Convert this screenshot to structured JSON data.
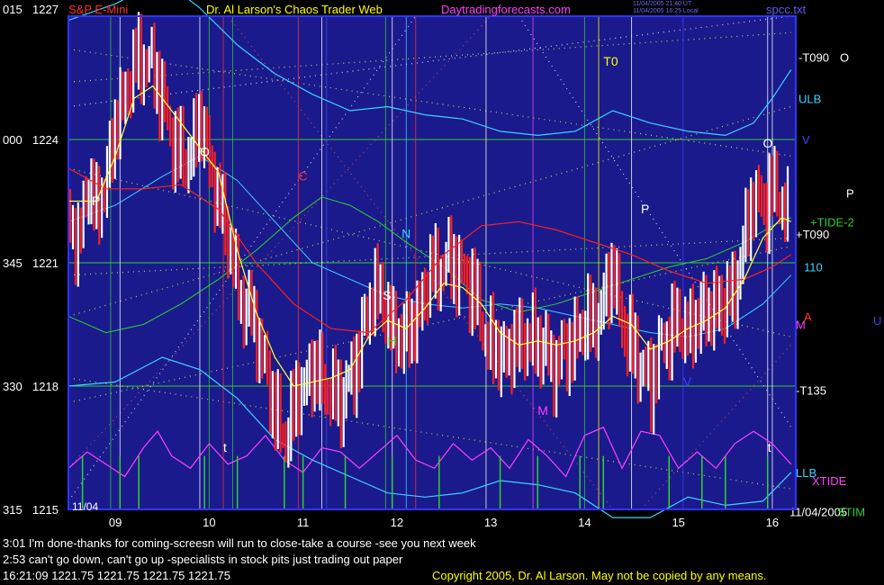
{
  "header": {
    "left_code": "015",
    "left_price": "1227",
    "symbol": "S&P E-Mini",
    "title": "Dr. Al Larson's Chaos Trader Web",
    "site": "Daytradingforecasts.com",
    "date_line1": "11/04/2005 21:40 UT",
    "date_line2": "11/04/2005 16:25 Local",
    "file": "spcc.txt"
  },
  "colors": {
    "background": "#000000",
    "plot_bg": "#1a1a8c",
    "frame": "#3333ff",
    "price_up": "#ffffff",
    "price_down": "#ff2020",
    "ema_fast": "#ffff40",
    "band_outer": "#40d0ff",
    "green": "#30d030",
    "magenta": "#ff40ff",
    "title_red": "#ff3030",
    "title_yellow": "#ffff00",
    "site_magenta": "#ff40ff"
  },
  "left_axis": [
    {
      "code": "000",
      "price": "1224"
    },
    {
      "code": "345",
      "price": "1221"
    },
    {
      "code": "330",
      "price": "1218"
    },
    {
      "code": "315",
      "price": "1215"
    }
  ],
  "right_labels": [
    {
      "text": "-T090",
      "extra": "O",
      "color": "#ffffff"
    },
    {
      "text": "ULB",
      "color": "#40d0ff"
    },
    {
      "text": "V",
      "color": "#4040ff"
    },
    {
      "text": "P",
      "color": "#ffffff"
    },
    {
      "text": "+TIDE-2",
      "color": "#30d030"
    },
    {
      "text": "+T090",
      "color": "#ffffff"
    },
    {
      "text": "110",
      "color": "#40d0ff"
    },
    {
      "text": "A",
      "color": "#ff3030"
    },
    {
      "text": "M",
      "color": "#ff40ff"
    },
    {
      "text": "U",
      "color": "#4040ff"
    },
    {
      "text": "-T135",
      "color": "#ffffff"
    },
    {
      "text": "LLB",
      "color": "#40d0ff"
    },
    {
      "text": "XTIDE",
      "color": "#ff40ff"
    },
    {
      "text": "11/04/2005",
      "color": "#ffffff"
    },
    {
      "text": "STIM",
      "color": "#30d030"
    }
  ],
  "annotations": [
    {
      "text": "O",
      "color": "#ffffff"
    },
    {
      "text": "P",
      "color": "#ffffff"
    },
    {
      "text": "C",
      "color": "#ff3030"
    },
    {
      "text": "N",
      "color": "#40d0ff"
    },
    {
      "text": "S",
      "color": "#ffffff"
    },
    {
      "text": "H",
      "color": "#30d030"
    },
    {
      "text": "T0",
      "color": "#ffff00"
    },
    {
      "text": "P",
      "color": "#ffffff"
    },
    {
      "text": "O",
      "color": "#ffffff"
    },
    {
      "text": "M",
      "color": "#ff40ff"
    },
    {
      "text": "V",
      "color": "#4040ff"
    },
    {
      "text": "t",
      "color": "#ffffff"
    },
    {
      "text": "t",
      "color": "#ffffff"
    }
  ],
  "date_corner": "11/04",
  "messages": {
    "line1": "3:01 I'm done-thanks for coming-screesn will run to close-take a course -see you next week",
    "line2": "2:53 can't go down, can't go up -specialists in stock pits just trading out paper",
    "line3": "16:21:09  1221.75 1221.75 1221.75 1221.75",
    "copyright": "Copyright 2005, Dr. Al Larson. May not be copied by any means."
  },
  "chart_data": {
    "type": "candlestick",
    "x_unit": "hour",
    "x_ticks": [
      "09",
      "10",
      "11",
      "12",
      "13",
      "14",
      "15",
      "16"
    ],
    "xlim": [
      8.5,
      16.25
    ],
    "ylim": [
      1215,
      1227
    ],
    "y_ticks": [
      1215,
      1218,
      1221,
      1224,
      1227
    ],
    "grid_h": [
      1215,
      1218,
      1221,
      1224
    ],
    "vlines": [
      {
        "x": 8.5,
        "color": "#ffffff"
      },
      {
        "x": 8.95,
        "color": "#30d030"
      },
      {
        "x": 9.05,
        "color": "#ffffff"
      },
      {
        "x": 9.9,
        "color": "#ffffff"
      },
      {
        "x": 10.0,
        "color": "#30d030"
      },
      {
        "x": 10.15,
        "color": "#ff3030"
      },
      {
        "x": 10.25,
        "color": "#30d030"
      },
      {
        "x": 10.95,
        "color": "#ff3030"
      },
      {
        "x": 11.2,
        "color": "#ffffff"
      },
      {
        "x": 11.25,
        "color": "#4040ff"
      },
      {
        "x": 11.88,
        "color": "#30d030"
      },
      {
        "x": 11.95,
        "color": "#ffffff"
      },
      {
        "x": 12.1,
        "color": "#40d0ff"
      },
      {
        "x": 12.2,
        "color": "#ff3030"
      },
      {
        "x": 12.95,
        "color": "#ffffff"
      },
      {
        "x": 13.45,
        "color": "#ff40ff"
      },
      {
        "x": 14.0,
        "color": "#30d030"
      },
      {
        "x": 14.15,
        "color": "#ffff00"
      },
      {
        "x": 14.5,
        "color": "#ffffff"
      },
      {
        "x": 15.05,
        "color": "#4040ff"
      },
      {
        "x": 15.95,
        "color": "#ffffff"
      },
      {
        "x": 16.0,
        "color": "#ffffff"
      }
    ],
    "price_path": [
      [
        8.5,
        1222.2
      ],
      [
        8.6,
        1221.4
      ],
      [
        8.7,
        1222.9
      ],
      [
        8.8,
        1222.3
      ],
      [
        8.9,
        1223.0
      ],
      [
        9.0,
        1224.3
      ],
      [
        9.1,
        1225.1
      ],
      [
        9.2,
        1225.8
      ],
      [
        9.35,
        1226.0
      ],
      [
        9.5,
        1225.0
      ],
      [
        9.6,
        1224.0
      ],
      [
        9.75,
        1223.4
      ],
      [
        9.9,
        1224.5
      ],
      [
        10.05,
        1223.0
      ],
      [
        10.2,
        1221.6
      ],
      [
        10.35,
        1220.0
      ],
      [
        10.5,
        1219.5
      ],
      [
        10.65,
        1217.8
      ],
      [
        10.8,
        1216.7
      ],
      [
        10.95,
        1217.8
      ],
      [
        11.1,
        1218.4
      ],
      [
        11.25,
        1218.0
      ],
      [
        11.4,
        1217.6
      ],
      [
        11.6,
        1218.8
      ],
      [
        11.75,
        1220.5
      ],
      [
        11.9,
        1219.7
      ],
      [
        12.05,
        1219.1
      ],
      [
        12.2,
        1219.6
      ],
      [
        12.35,
        1220.7
      ],
      [
        12.5,
        1221.0
      ],
      [
        12.65,
        1220.9
      ],
      [
        12.8,
        1220.4
      ],
      [
        12.95,
        1219.2
      ],
      [
        13.1,
        1218.7
      ],
      [
        13.25,
        1219.0
      ],
      [
        13.45,
        1219.2
      ],
      [
        13.55,
        1218.9
      ],
      [
        13.7,
        1218.5
      ],
      [
        13.85,
        1219.0
      ],
      [
        14.0,
        1219.5
      ],
      [
        14.15,
        1219.7
      ],
      [
        14.3,
        1220.8
      ],
      [
        14.45,
        1219.1
      ],
      [
        14.55,
        1218.8
      ],
      [
        14.7,
        1218.0
      ],
      [
        14.85,
        1219.2
      ],
      [
        15.0,
        1219.5
      ],
      [
        15.15,
        1219.4
      ],
      [
        15.3,
        1219.9
      ],
      [
        15.45,
        1219.9
      ],
      [
        15.6,
        1220.4
      ],
      [
        15.7,
        1221.4
      ],
      [
        15.8,
        1222.8
      ],
      [
        15.9,
        1222.2
      ],
      [
        16.0,
        1222.9
      ],
      [
        16.1,
        1222.5
      ],
      [
        16.2,
        1221.8
      ]
    ],
    "ema_fast": [
      [
        8.5,
        1222.5
      ],
      [
        8.8,
        1222.5
      ],
      [
        9.0,
        1223.6
      ],
      [
        9.2,
        1225.0
      ],
      [
        9.4,
        1225.3
      ],
      [
        9.6,
        1224.7
      ],
      [
        9.9,
        1223.8
      ],
      [
        10.1,
        1223.2
      ],
      [
        10.3,
        1221.3
      ],
      [
        10.5,
        1219.8
      ],
      [
        10.7,
        1218.7
      ],
      [
        10.9,
        1218.0
      ],
      [
        11.1,
        1218.1
      ],
      [
        11.3,
        1218.2
      ],
      [
        11.5,
        1218.4
      ],
      [
        11.7,
        1219.2
      ],
      [
        11.9,
        1219.6
      ],
      [
        12.1,
        1219.4
      ],
      [
        12.3,
        1219.9
      ],
      [
        12.5,
        1220.5
      ],
      [
        12.7,
        1220.4
      ],
      [
        12.9,
        1220.0
      ],
      [
        13.1,
        1219.3
      ],
      [
        13.3,
        1219.0
      ],
      [
        13.5,
        1219.1
      ],
      [
        13.7,
        1219.0
      ],
      [
        13.9,
        1219.1
      ],
      [
        14.1,
        1219.3
      ],
      [
        14.3,
        1219.7
      ],
      [
        14.5,
        1219.5
      ],
      [
        14.7,
        1218.9
      ],
      [
        14.9,
        1219.1
      ],
      [
        15.1,
        1219.4
      ],
      [
        15.3,
        1219.6
      ],
      [
        15.5,
        1219.9
      ],
      [
        15.7,
        1220.6
      ],
      [
        15.9,
        1221.6
      ],
      [
        16.1,
        1222.1
      ],
      [
        16.2,
        1222.0
      ]
    ],
    "ema_slow": [
      [
        8.5,
        1223.3
      ],
      [
        8.9,
        1222.8
      ],
      [
        9.3,
        1222.8
      ],
      [
        9.7,
        1222.9
      ],
      [
        10.1,
        1222.3
      ],
      [
        10.5,
        1221.0
      ],
      [
        10.9,
        1220.0
      ],
      [
        11.3,
        1219.4
      ],
      [
        11.7,
        1219.3
      ],
      [
        12.1,
        1220.1
      ],
      [
        12.5,
        1221.2
      ],
      [
        12.9,
        1221.9
      ],
      [
        13.3,
        1222.0
      ],
      [
        13.7,
        1221.8
      ],
      [
        14.1,
        1221.5
      ],
      [
        14.5,
        1221.2
      ],
      [
        14.9,
        1220.8
      ],
      [
        15.3,
        1220.5
      ],
      [
        15.7,
        1220.6
      ],
      [
        16.0,
        1220.9
      ],
      [
        16.2,
        1221.2
      ]
    ],
    "green_band": [
      [
        8.5,
        1219.7
      ],
      [
        8.9,
        1219.3
      ],
      [
        9.3,
        1219.5
      ],
      [
        9.7,
        1220.0
      ],
      [
        10.1,
        1220.6
      ],
      [
        10.5,
        1221.3
      ],
      [
        10.9,
        1222.1
      ],
      [
        11.2,
        1222.6
      ],
      [
        11.5,
        1222.4
      ],
      [
        11.8,
        1222.0
      ],
      [
        12.1,
        1221.5
      ],
      [
        12.5,
        1220.9
      ],
      [
        12.9,
        1220.1
      ],
      [
        13.3,
        1219.8
      ],
      [
        13.7,
        1220.0
      ],
      [
        14.1,
        1220.3
      ],
      [
        14.5,
        1220.6
      ],
      [
        14.9,
        1220.9
      ],
      [
        15.3,
        1221.1
      ],
      [
        15.7,
        1221.5
      ],
      [
        16.0,
        1221.9
      ],
      [
        16.2,
        1222.1
      ]
    ],
    "upper_band": [
      [
        8.5,
        1226.9
      ],
      [
        9.0,
        1227.3
      ],
      [
        9.5,
        1227.9
      ],
      [
        9.9,
        1227.2
      ],
      [
        10.3,
        1226.3
      ],
      [
        10.7,
        1225.6
      ],
      [
        11.1,
        1225.1
      ],
      [
        11.5,
        1224.7
      ],
      [
        11.9,
        1224.8
      ],
      [
        12.3,
        1224.6
      ],
      [
        12.7,
        1224.5
      ],
      [
        13.1,
        1224.2
      ],
      [
        13.5,
        1224.1
      ],
      [
        13.9,
        1224.2
      ],
      [
        14.3,
        1224.7
      ],
      [
        14.7,
        1224.4
      ],
      [
        15.1,
        1224.2
      ],
      [
        15.5,
        1224.1
      ],
      [
        15.8,
        1224.4
      ],
      [
        16.0,
        1225.0
      ],
      [
        16.2,
        1225.7
      ]
    ],
    "mid_band": [
      [
        8.5,
        1222.0
      ],
      [
        9.0,
        1222.4
      ],
      [
        9.5,
        1223.1
      ],
      [
        9.9,
        1223.6
      ],
      [
        10.3,
        1223.0
      ],
      [
        10.7,
        1222.0
      ],
      [
        11.1,
        1221.0
      ],
      [
        11.5,
        1220.6
      ],
      [
        11.9,
        1220.2
      ],
      [
        12.3,
        1220.0
      ],
      [
        12.7,
        1219.9
      ],
      [
        13.1,
        1220.0
      ],
      [
        13.5,
        1219.9
      ],
      [
        13.9,
        1219.7
      ],
      [
        14.3,
        1219.5
      ],
      [
        14.7,
        1219.3
      ],
      [
        15.1,
        1219.2
      ],
      [
        15.5,
        1219.4
      ],
      [
        15.9,
        1220.0
      ],
      [
        16.2,
        1220.7
      ]
    ],
    "lower_band": [
      [
        8.5,
        1218.0
      ],
      [
        9.0,
        1218.1
      ],
      [
        9.5,
        1218.7
      ],
      [
        9.9,
        1218.4
      ],
      [
        10.3,
        1217.7
      ],
      [
        10.7,
        1216.7
      ],
      [
        11.1,
        1216.2
      ],
      [
        11.5,
        1215.8
      ],
      [
        11.9,
        1215.4
      ],
      [
        12.3,
        1215.3
      ],
      [
        12.7,
        1215.4
      ],
      [
        13.1,
        1215.7
      ],
      [
        13.5,
        1215.6
      ],
      [
        13.9,
        1215.4
      ],
      [
        14.3,
        1214.8
      ],
      [
        14.7,
        1214.8
      ],
      [
        15.1,
        1215.3
      ],
      [
        15.5,
        1215.1
      ],
      [
        15.9,
        1215.2
      ],
      [
        16.2,
        1215.9
      ]
    ],
    "oscillator": [
      [
        8.5,
        1216.0
      ],
      [
        8.7,
        1216.4
      ],
      [
        8.9,
        1216.1
      ],
      [
        9.1,
        1215.8
      ],
      [
        9.3,
        1216.5
      ],
      [
        9.45,
        1216.9
      ],
      [
        9.6,
        1216.3
      ],
      [
        9.8,
        1216.0
      ],
      [
        10.0,
        1216.6
      ],
      [
        10.2,
        1216.1
      ],
      [
        10.4,
        1216.3
      ],
      [
        10.6,
        1216.8
      ],
      [
        10.8,
        1216.2
      ],
      [
        11.0,
        1215.9
      ],
      [
        11.2,
        1216.5
      ],
      [
        11.4,
        1216.4
      ],
      [
        11.6,
        1216.0
      ],
      [
        11.8,
        1216.4
      ],
      [
        12.0,
        1216.8
      ],
      [
        12.2,
        1216.2
      ],
      [
        12.4,
        1216.0
      ],
      [
        12.6,
        1216.6
      ],
      [
        12.8,
        1216.2
      ],
      [
        13.0,
        1216.5
      ],
      [
        13.2,
        1216.0
      ],
      [
        13.4,
        1216.7
      ],
      [
        13.6,
        1216.3
      ],
      [
        13.8,
        1215.8
      ],
      [
        14.0,
        1216.8
      ],
      [
        14.2,
        1217.0
      ],
      [
        14.4,
        1216.0
      ],
      [
        14.6,
        1216.9
      ],
      [
        14.8,
        1216.8
      ],
      [
        15.0,
        1216.0
      ],
      [
        15.2,
        1216.4
      ],
      [
        15.4,
        1216.0
      ],
      [
        15.6,
        1216.6
      ],
      [
        15.8,
        1216.9
      ],
      [
        16.0,
        1216.6
      ],
      [
        16.2,
        1216.1
      ]
    ],
    "spikes_x": [
      8.65,
      9.05,
      9.25,
      9.95,
      10.3,
      10.8,
      11.0,
      11.45,
      11.95,
      12.45,
      13.1,
      13.5,
      13.95,
      14.2,
      14.9,
      15.25,
      15.5,
      15.95
    ]
  }
}
